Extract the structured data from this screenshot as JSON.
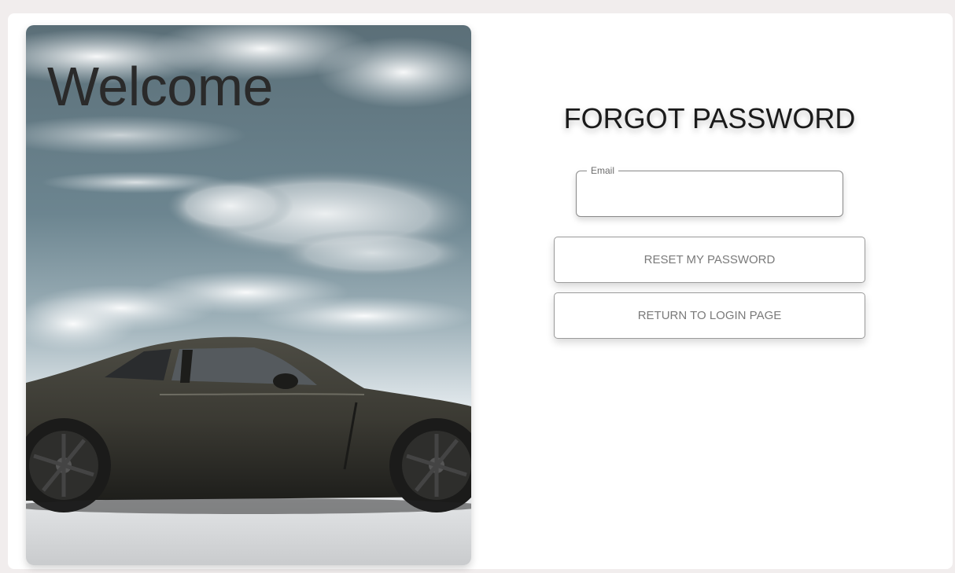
{
  "hero": {
    "welcome_text": "Welcome",
    "image_description_icon": "sports-car-photo"
  },
  "form": {
    "title": "FORGOT PASSWORD",
    "email_label": "Email",
    "email_value": "",
    "reset_button_label": "RESET MY PASSWORD",
    "return_button_label": "RETURN TO LOGIN PAGE"
  },
  "colors": {
    "page_bg": "#f1eded",
    "card_bg": "#ffffff",
    "title_text": "#1a1a1a",
    "button_text": "#7a7a7a",
    "border": "#9a9a9a"
  }
}
